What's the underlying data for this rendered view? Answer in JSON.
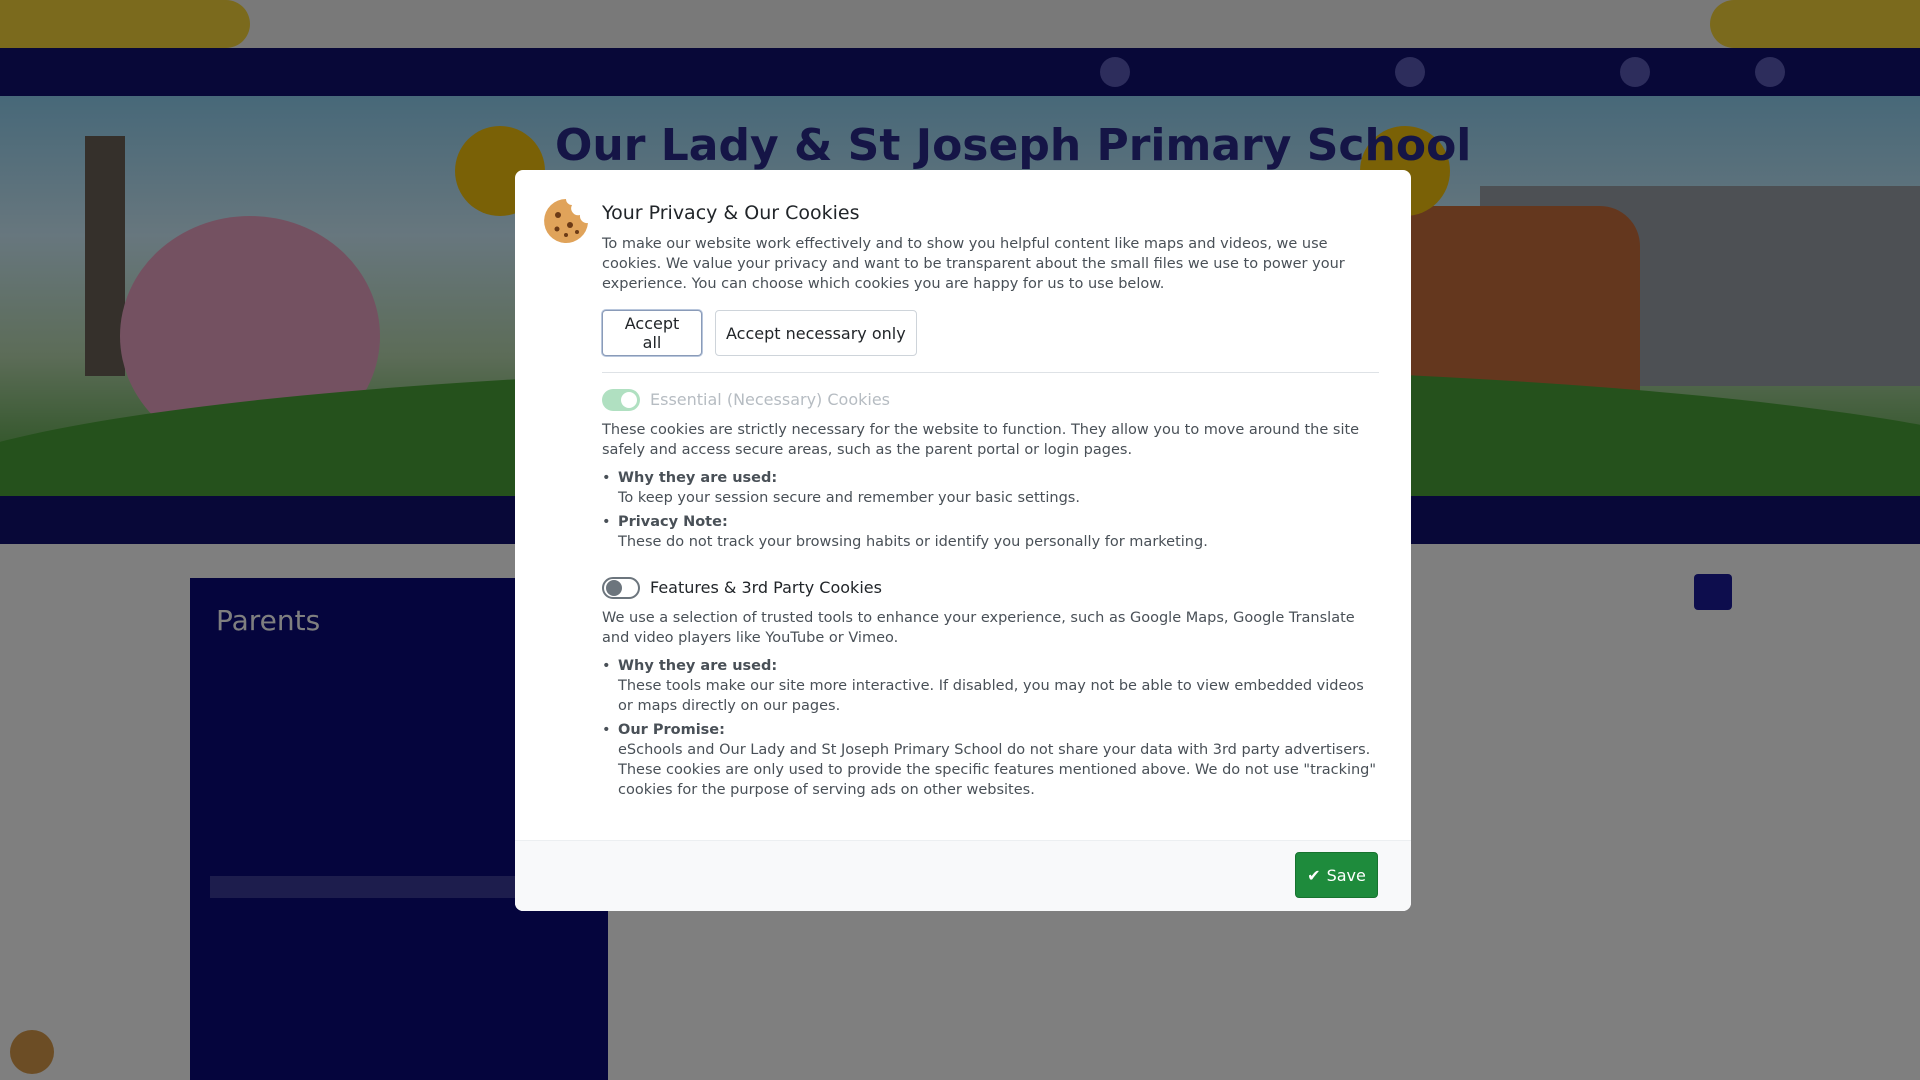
{
  "background": {
    "hero_title": "Our Lady & St Joseph Primary School",
    "topbar_text": "",
    "side_title": "Parents"
  },
  "modal": {
    "title": "Your Privacy & Our Cookies",
    "intro": "To make our website work effectively and to show you helpful content like maps and videos, we use cookies. We value your privacy and want to be transparent about the small files we use to power your experience. You can choose which cookies you are happy for us to use below.",
    "accept_all_label": "Accept all",
    "accept_necessary_label": "Accept necessary only",
    "essential": {
      "title": "Essential (Necessary) Cookies",
      "enabled": true,
      "description": "These cookies are strictly necessary for the website to function. They allow you to move around the site safely and access secure areas, such as the parent portal or login pages.",
      "bullets": [
        {
          "heading": "Why they are used:",
          "text": "To keep your session secure and remember your basic settings."
        },
        {
          "heading": "Privacy Note:",
          "text": "These do not track your browsing habits or identify you personally for marketing."
        }
      ]
    },
    "features": {
      "title": "Features & 3rd Party Cookies",
      "enabled": false,
      "description": "We use a selection of trusted tools to enhance your experience, such as Google Maps, Google Translate and video players like YouTube or Vimeo.",
      "bullets": [
        {
          "heading": "Why they are used:",
          "text": "These tools make our site more interactive. If disabled, you may not be able to view embedded videos or maps directly on our pages."
        },
        {
          "heading": "Our Promise:",
          "text": "eSchools and Our Lady and St Joseph Primary School do not share your data with 3rd party advertisers. These cookies are only used to provide the specific features mentioned above. We do not use \"tracking\" cookies for the purpose of serving ads on other websites."
        }
      ]
    },
    "save_label": "Save",
    "icons": {
      "cookie": "cookie-icon",
      "save": "check-icon"
    },
    "colors": {
      "save_button": "#1e8b3c",
      "toggle_on": "#8fd4a8",
      "title": "#212529",
      "body_text": "#495057"
    }
  }
}
